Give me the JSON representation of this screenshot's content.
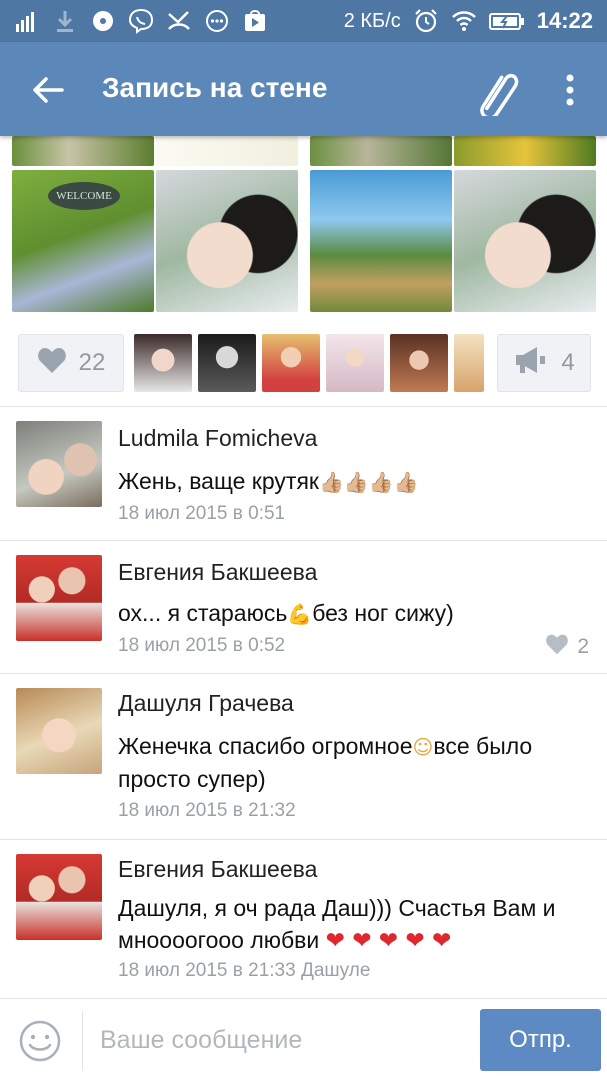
{
  "status_bar": {
    "speed": "2 КБ/с",
    "time": "14:22",
    "icons": [
      "signal-icon",
      "download-icon",
      "music-icon",
      "viber-icon",
      "missed-call-icon",
      "chat-icon",
      "play-store-icon",
      "alarm-icon",
      "wifi-icon",
      "battery-icon"
    ]
  },
  "app_bar": {
    "title": "Запись на стене",
    "icons": [
      "back-arrow-icon",
      "paperclip-icon",
      "more-vert-icon"
    ]
  },
  "photos": {
    "sign_text": "WELCOME"
  },
  "likes": {
    "like_count": "22",
    "share_count": "4"
  },
  "comments": [
    {
      "author": "Ludmila Fomicheva",
      "text": "Жень, ваще крутяк",
      "emoji": "👍🏼👍🏼👍🏼👍🏼",
      "date": "18 июл 2015 в 0:51"
    },
    {
      "author": "Евгения Бакшеева",
      "text_before": "ох... я стараюсь",
      "emoji": "💪",
      "text_after": "без ног сижу)",
      "date": "18 июл 2015 в 0:52",
      "likes": "2"
    },
    {
      "author": "Дашуля Грачева",
      "text_before": "Женечка спасибо огромное",
      "emoji": "☺",
      "text_after": "все было просто супер)",
      "date": "18 июл 2015 в 21:32"
    },
    {
      "author": "Евгения Бакшеева",
      "text": "Дашуля, я оч рада Даш))) Счастья Вам и мноооогооо любви",
      "hearts": "❤ ❤ ❤ ❤ ❤",
      "date": "18 июл 2015 в 21:33",
      "reply_to": "Дашуле"
    }
  ],
  "compose": {
    "placeholder": "Ваше сообщение",
    "send_label": "Отпр."
  },
  "colors": {
    "status_bar": "#4e77a4",
    "app_bar": "#5b88b8",
    "send_button": "#5d8ac2",
    "meta_text": "#9aa0a7"
  }
}
